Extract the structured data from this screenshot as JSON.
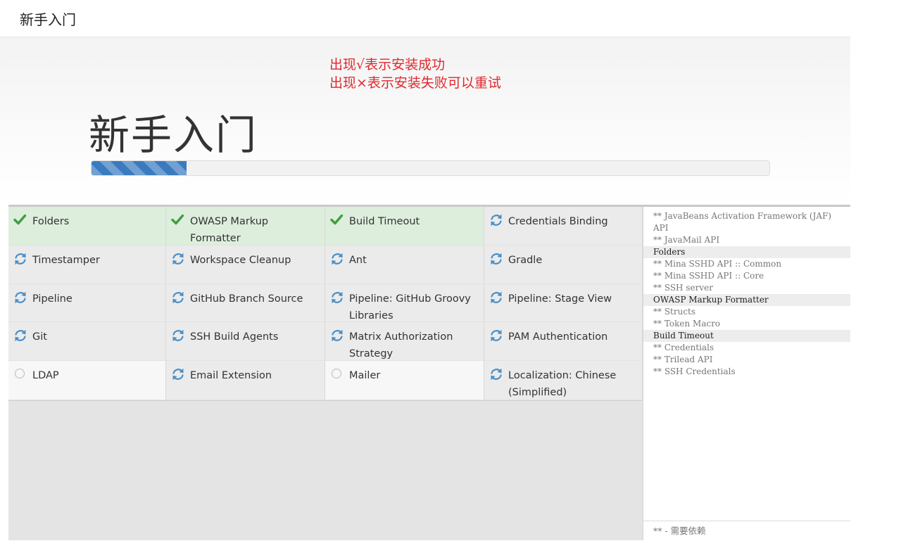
{
  "header": {
    "title": "新手入门"
  },
  "hero": {
    "notes": [
      "出现√表示安装成功",
      "出现×表示安装失败可以重试"
    ],
    "title": "新手入门",
    "progress": 0.14,
    "progress_color": "#3a7bbf"
  },
  "colors": {
    "success": "#3f9f3f",
    "pending": "#4a8fc7",
    "waiting": "#c6c6c6",
    "note": "#e0282e"
  },
  "plugins": [
    {
      "name": "Folders",
      "status": "success",
      "icon": "check-icon"
    },
    {
      "name": "OWASP Markup Formatter",
      "status": "success",
      "icon": "check-icon"
    },
    {
      "name": "Build Timeout",
      "status": "success",
      "icon": "check-icon"
    },
    {
      "name": "Credentials Binding",
      "status": "pending",
      "icon": "refresh-icon"
    },
    {
      "name": "Timestamper",
      "status": "pending",
      "icon": "refresh-icon"
    },
    {
      "name": "Workspace Cleanup",
      "status": "pending",
      "icon": "refresh-icon"
    },
    {
      "name": "Ant",
      "status": "pending",
      "icon": "refresh-icon"
    },
    {
      "name": "Gradle",
      "status": "pending",
      "icon": "refresh-icon"
    },
    {
      "name": "Pipeline",
      "status": "pending",
      "icon": "refresh-icon"
    },
    {
      "name": "GitHub Branch Source",
      "status": "pending",
      "icon": "refresh-icon"
    },
    {
      "name": "Pipeline: GitHub Groovy Libraries",
      "status": "pending",
      "icon": "refresh-icon"
    },
    {
      "name": "Pipeline: Stage View",
      "status": "pending",
      "icon": "refresh-icon"
    },
    {
      "name": "Git",
      "status": "pending",
      "icon": "refresh-icon"
    },
    {
      "name": "SSH Build Agents",
      "status": "pending",
      "icon": "refresh-icon"
    },
    {
      "name": "Matrix Authorization Strategy",
      "status": "pending",
      "icon": "refresh-icon"
    },
    {
      "name": "PAM Authentication",
      "status": "pending",
      "icon": "refresh-icon"
    },
    {
      "name": "LDAP",
      "status": "waiting",
      "icon": "circle-icon"
    },
    {
      "name": "Email Extension",
      "status": "pending",
      "icon": "refresh-icon"
    },
    {
      "name": "Mailer",
      "status": "waiting",
      "icon": "circle-icon"
    },
    {
      "name": "Localization: Chinese (Simplified)",
      "status": "pending",
      "icon": "refresh-icon"
    }
  ],
  "log": {
    "lines": [
      {
        "text": "** JavaBeans Activation Framework (JAF) API",
        "head": false
      },
      {
        "text": "** JavaMail API",
        "head": false
      },
      {
        "text": "Folders",
        "head": true
      },
      {
        "text": "** Mina SSHD API :: Common",
        "head": false
      },
      {
        "text": "** Mina SSHD API :: Core",
        "head": false
      },
      {
        "text": "** SSH server",
        "head": false
      },
      {
        "text": "OWASP Markup Formatter",
        "head": true
      },
      {
        "text": "** Structs",
        "head": false
      },
      {
        "text": "** Token Macro",
        "head": false
      },
      {
        "text": "Build Timeout",
        "head": true
      },
      {
        "text": "** Credentials",
        "head": false
      },
      {
        "text": "** Trilead API",
        "head": false
      },
      {
        "text": "** SSH Credentials",
        "head": false
      }
    ],
    "footer": "** - 需要依赖"
  }
}
